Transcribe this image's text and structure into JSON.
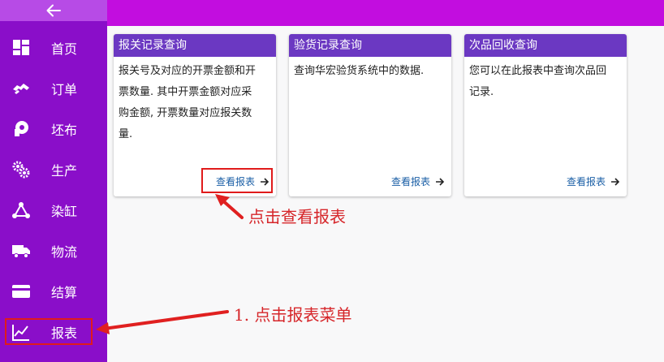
{
  "sidebar": {
    "items": [
      {
        "label": "首页",
        "icon": "dashboard-icon"
      },
      {
        "label": "订单",
        "icon": "handshake-icon"
      },
      {
        "label": "坯布",
        "icon": "fabric-roll-icon"
      },
      {
        "label": "生产",
        "icon": "gears-icon"
      },
      {
        "label": "染缸",
        "icon": "network-icon"
      },
      {
        "label": "物流",
        "icon": "truck-icon"
      },
      {
        "label": "结算",
        "icon": "credit-card-icon"
      },
      {
        "label": "报表",
        "icon": "line-chart-icon"
      }
    ]
  },
  "cards": [
    {
      "title": "报关记录查询",
      "lines": [
        "报关号及对应的开票金额和开",
        "票数量. 其中开票金额对应采",
        "购金额, 开票数量对应报关数",
        "量."
      ],
      "link": "查看报表"
    },
    {
      "title": "验货记录查询",
      "lines": [
        "查询华宏验货系统中的数据."
      ],
      "link": "查看报表"
    },
    {
      "title": "次品回收查询",
      "lines": [
        "您可以在此报表中查询次品回",
        "记录."
      ],
      "link": "查看报表"
    }
  ],
  "annotations": {
    "view_report": "点击查看报表",
    "report_menu": "1. 点击报表菜单"
  },
  "colors": {
    "topbar": "#c20ddf",
    "sidebar": "#8a0ec9",
    "card_header": "#6b38c2",
    "annotation": "#d6262a",
    "link": "#1b5fa6"
  }
}
